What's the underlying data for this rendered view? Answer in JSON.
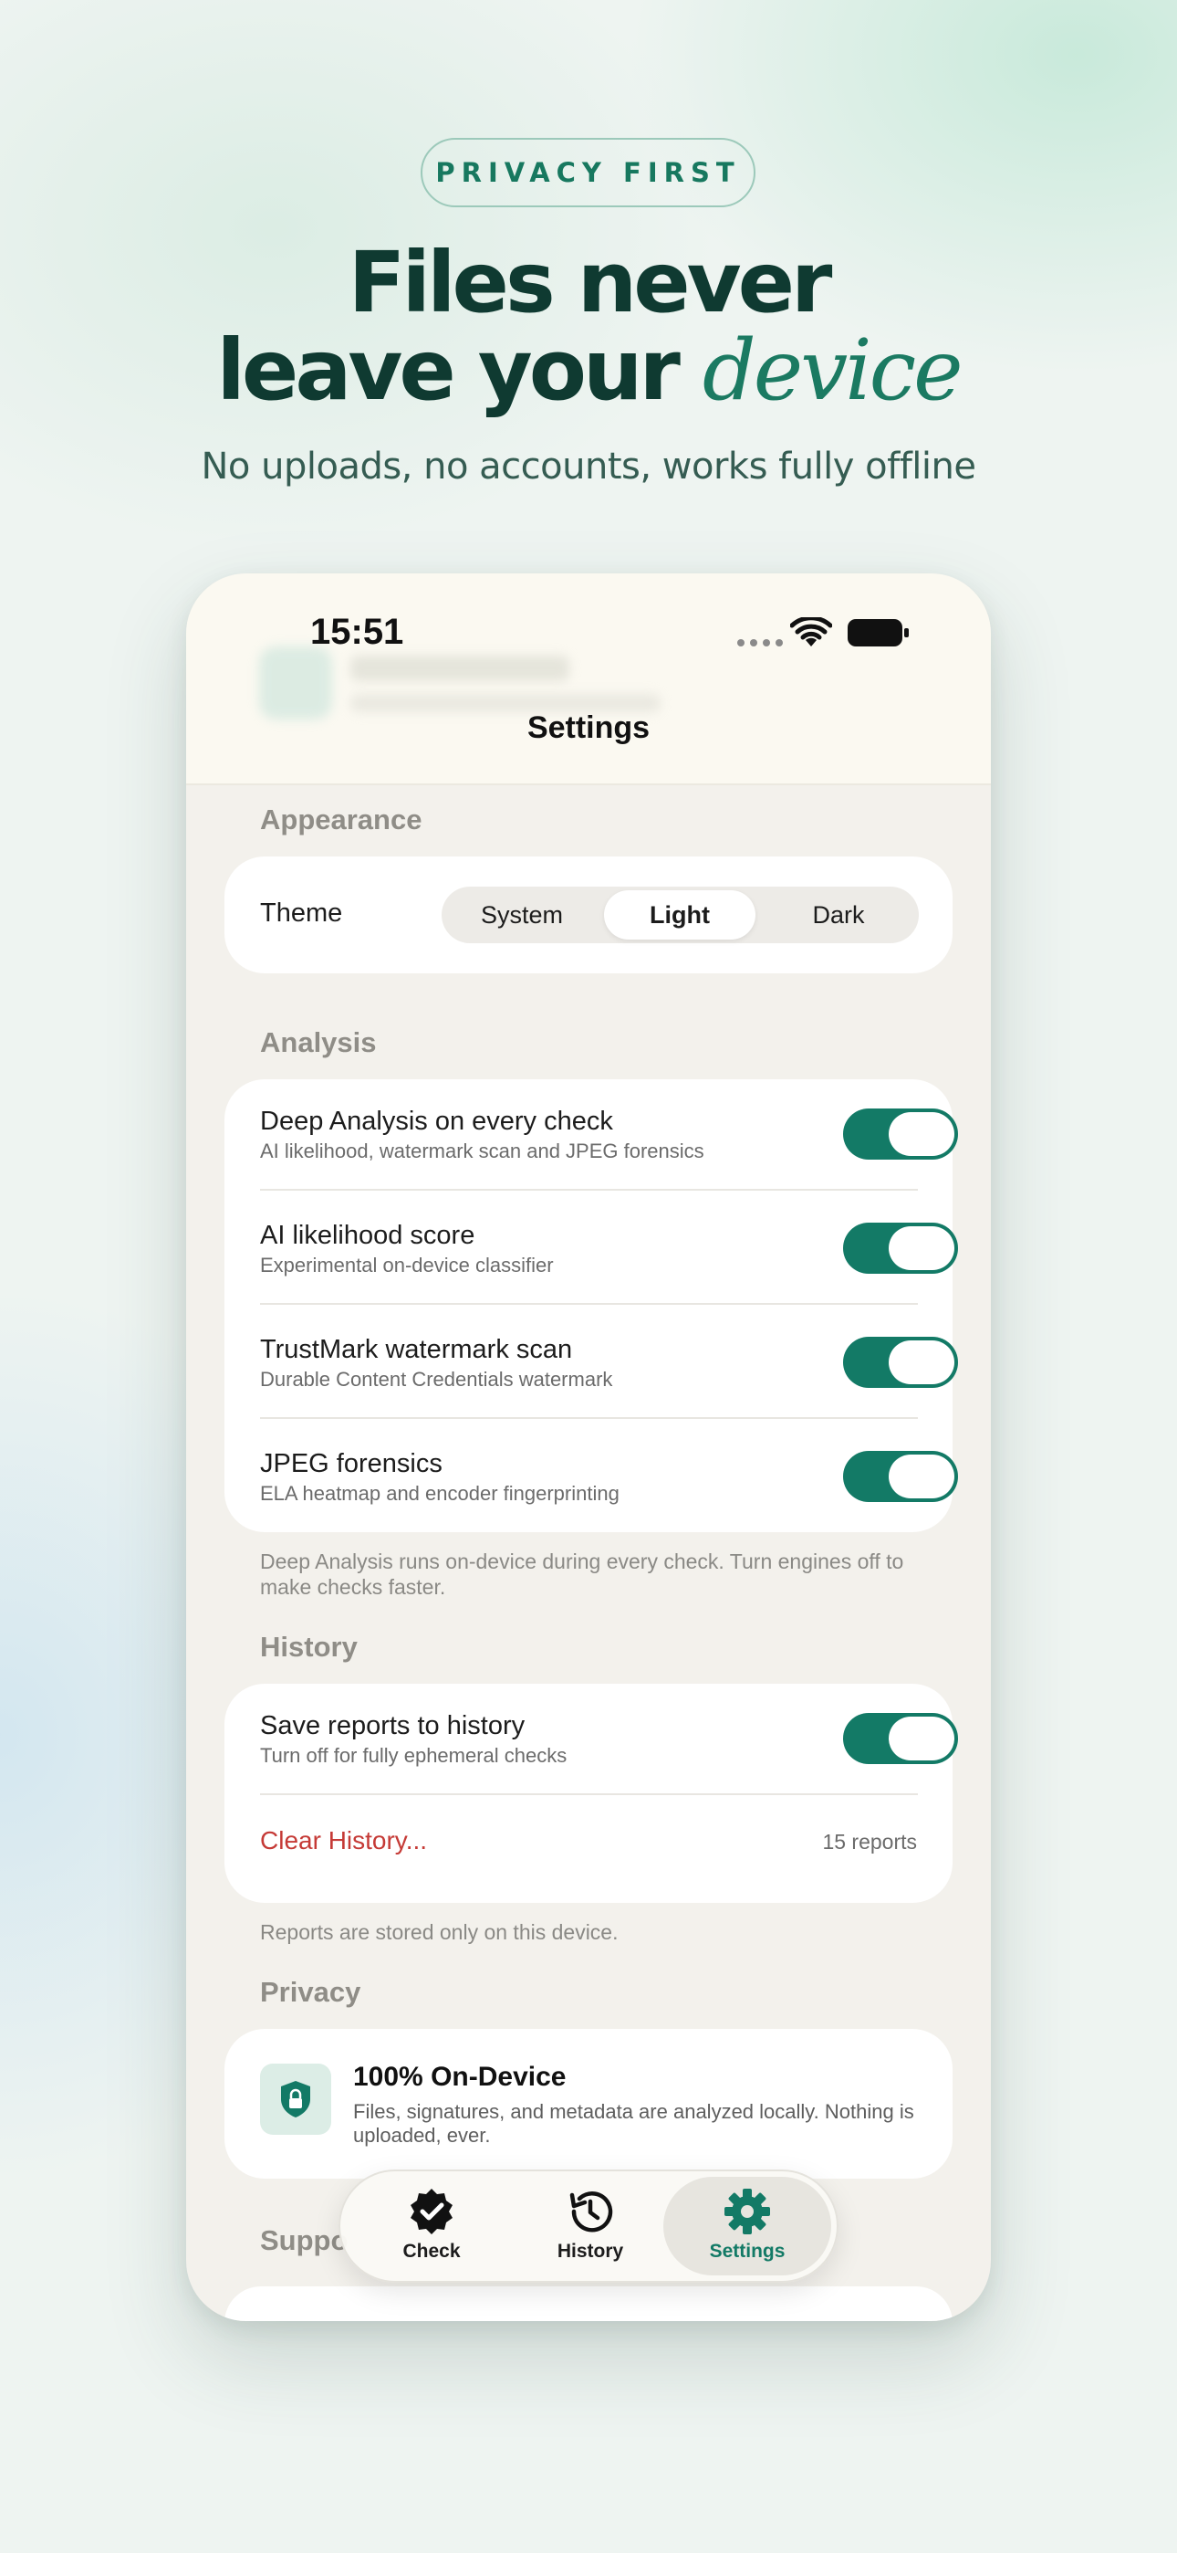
{
  "marketing": {
    "pill": "PRIVACY FIRST",
    "headline_line1": "Files never",
    "headline_line2": "leave your",
    "headline_accent": "device",
    "subline": "No uploads, no accounts, works fully offline"
  },
  "status_bar": {
    "time": "15:51"
  },
  "nav": {
    "title": "Settings"
  },
  "appearance": {
    "label": "Appearance",
    "theme_label": "Theme",
    "options": [
      "System",
      "Light",
      "Dark"
    ],
    "selected": "Light"
  },
  "analysis": {
    "label": "Analysis",
    "rows": [
      {
        "title": "Deep Analysis on every check",
        "subtitle": "AI likelihood, watermark scan and JPEG forensics",
        "on": true
      },
      {
        "title": "AI likelihood score",
        "subtitle": "Experimental on-device classifier",
        "on": true
      },
      {
        "title": "TrustMark watermark scan",
        "subtitle": "Durable Content Credentials watermark",
        "on": true
      },
      {
        "title": "JPEG forensics",
        "subtitle": "ELA heatmap and encoder fingerprinting",
        "on": true
      }
    ],
    "footnote": "Deep Analysis runs on-device during every check. Turn engines off to make checks faster."
  },
  "history": {
    "label": "History",
    "save_title": "Save reports to history",
    "save_subtitle": "Turn off for fully ephemeral checks",
    "save_on": true,
    "clear_label": "Clear History...",
    "count": "15 reports",
    "footnote": "Reports are stored only on this device."
  },
  "privacy": {
    "label": "Privacy",
    "title": "100% On-Device",
    "description": "Files, signatures, and metadata are analyzed locally. Nothing is uploaded, ever."
  },
  "support": {
    "label": "Suppo"
  },
  "tabbar": {
    "tabs": [
      {
        "label": "Check",
        "icon": "verified-badge-icon"
      },
      {
        "label": "History",
        "icon": "history-clock-icon"
      },
      {
        "label": "Settings",
        "icon": "gear-icon"
      }
    ],
    "active": "Settings"
  },
  "colors": {
    "accent": "#137a66",
    "danger": "#c53a36",
    "headline": "#0f3a31"
  }
}
